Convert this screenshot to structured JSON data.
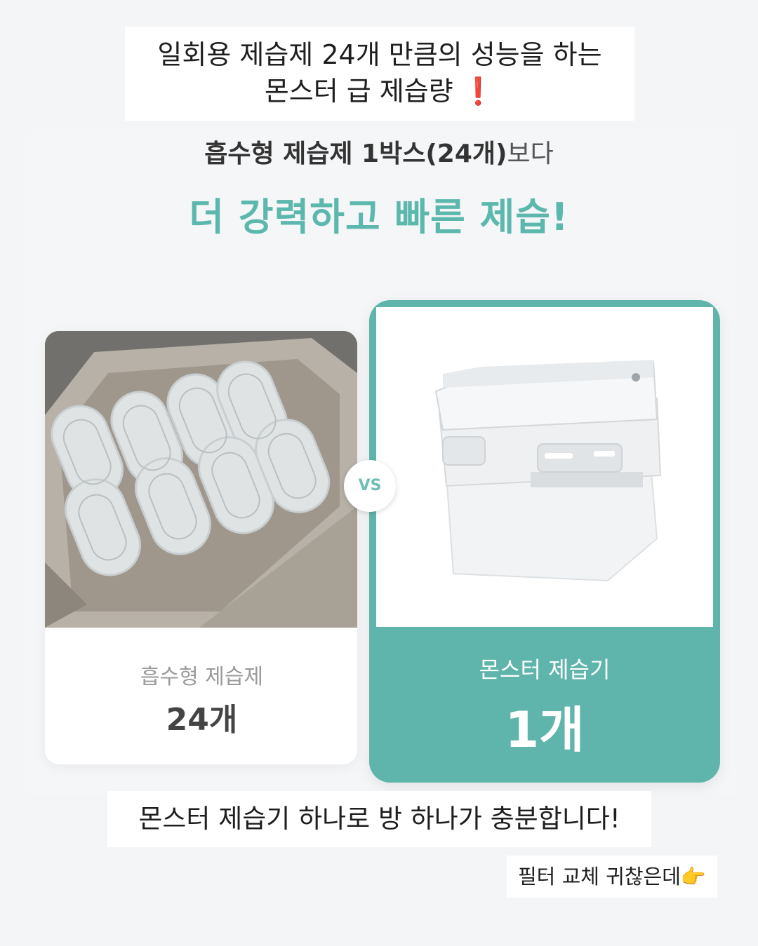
{
  "caption_top": {
    "line1": "일회용 제습제 24개 만큼의 성능을 하는",
    "line2": "몬스터 급 제습량",
    "emoji": "❗"
  },
  "ad": {
    "subtitle_bold": "흡수형 제습제 1박스(24개)",
    "subtitle_light": "보다",
    "headline": "더 강력하고 빠른 제습!",
    "accent_color": "#5fb5ab",
    "left_card": {
      "label": "흡수형 제습제",
      "count": "24개"
    },
    "vs": "VS",
    "right_card": {
      "label": "몬스터 제습기",
      "count": "1개"
    }
  },
  "caption_bottom": "몬스터 제습기 하나로 방 하나가 충분합니다!",
  "caption_small": {
    "text": "필터 교체 귀찮은데",
    "emoji": "👉"
  }
}
